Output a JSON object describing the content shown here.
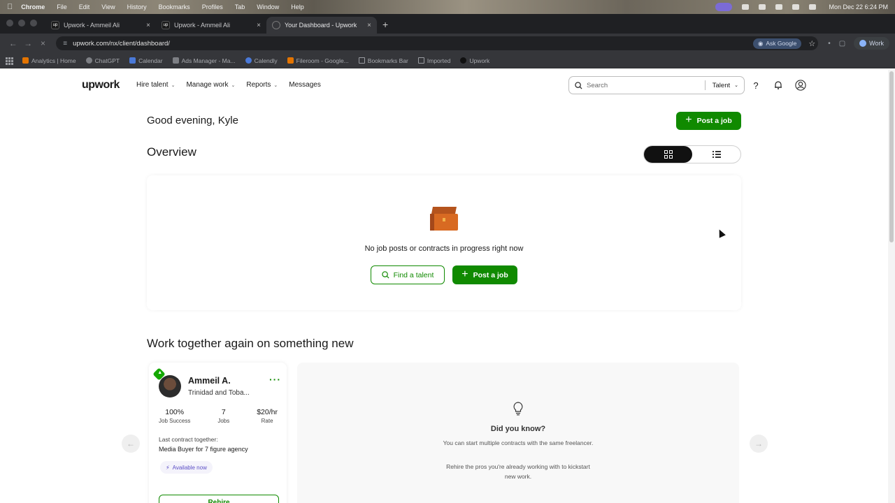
{
  "mac_menu": {
    "app": "Chrome",
    "items": [
      "File",
      "Edit",
      "View",
      "History",
      "Bookmarks",
      "Profiles",
      "Tab",
      "Window",
      "Help"
    ],
    "clock": "Mon Dec 22  6:24 PM"
  },
  "browser": {
    "tabs": [
      {
        "title": "Upwork - Ammeil Ali",
        "active": false
      },
      {
        "title": "Upwork - Ammeil Ali",
        "active": false
      },
      {
        "title": "Your Dashboard - Upwork",
        "active": true
      }
    ],
    "url": "upwork.com/nx/client/dashboard/",
    "ask_google": "Ask Google",
    "profile": "Work",
    "bookmarks": [
      "Analytics | Home",
      "ChatGPT",
      "Calendar",
      "Ads Manager - Ma...",
      "Calendly",
      "Fileroom - Google...",
      "Bookmarks Bar",
      "Imported",
      "Upwork"
    ]
  },
  "header": {
    "logo": "upwork",
    "nav": [
      "Hire talent",
      "Manage work",
      "Reports",
      "Messages"
    ],
    "search_placeholder": "Search",
    "search_scope": "Talent"
  },
  "main": {
    "greeting": "Good evening, Kyle",
    "post_job_label": "Post a job",
    "overview_title": "Overview",
    "empty_message": "No job posts or contracts in progress right now",
    "find_talent_label": "Find a talent",
    "work_again_title": "Work together again on something new"
  },
  "freelancer": {
    "name": "Ammeil A.",
    "location": "Trinidad and Toba...",
    "stats": [
      {
        "value": "100%",
        "label": "Job Success"
      },
      {
        "value": "7",
        "label": "Jobs"
      },
      {
        "value": "$20/hr",
        "label": "Rate"
      }
    ],
    "last_contract_label": "Last contract together:",
    "last_contract_value": "Media Buyer for 7 figure agency",
    "availability": "Available now",
    "rehire_label": "Rehire"
  },
  "did_you_know": {
    "title": "Did you know?",
    "text1": "You can start multiple contracts with the same freelancer.",
    "text2": "Rehire the pros you're already working with to kickstart new work."
  },
  "colors": {
    "brand_green": "#108a00",
    "availability_purple": "#5b4ec6"
  }
}
